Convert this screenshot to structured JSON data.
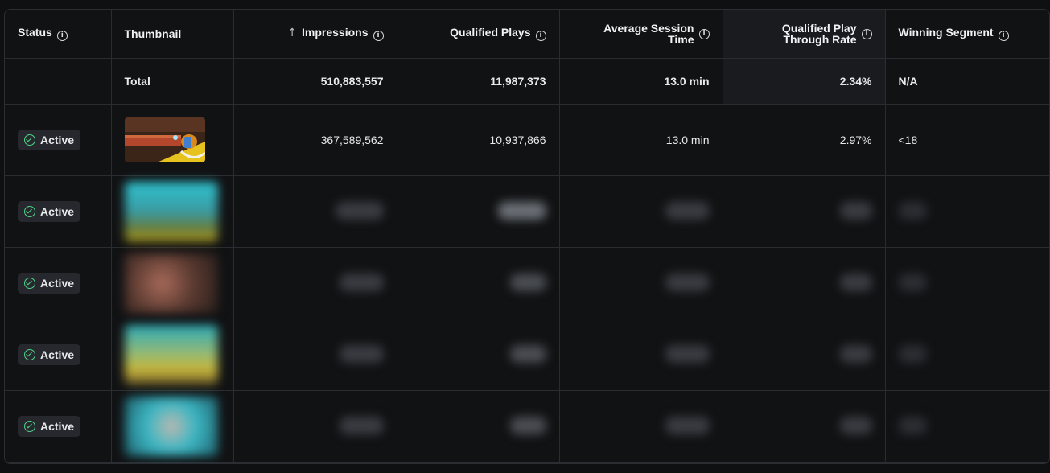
{
  "columns": {
    "status": "Status",
    "thumbnail": "Thumbnail",
    "impressions": "Impressions",
    "qualified_plays": "Qualified Plays",
    "avg_session_line1": "Average Session",
    "avg_session_line2": "Time",
    "qptr_line1": "Qualified Play",
    "qptr_line2": "Through Rate",
    "winning_segment": "Winning Segment"
  },
  "total": {
    "label": "Total",
    "impressions": "510,883,557",
    "qualified_plays": "11,987,373",
    "avg_session": "13.0 min",
    "qptr": "2.34%",
    "winning_segment": "N/A"
  },
  "rows": [
    {
      "status": "Active",
      "impressions": "367,589,562",
      "qualified_plays": "10,937,866",
      "avg_session": "13.0 min",
      "qptr": "2.97%",
      "winning_segment": "<18"
    },
    {
      "status": "Active"
    },
    {
      "status": "Active"
    },
    {
      "status": "Active"
    },
    {
      "status": "Active"
    }
  ],
  "icons": {
    "info": "info-icon",
    "sort": "arrow-up-icon",
    "status": "check-circle-icon"
  },
  "colors": {
    "active_check": "#4fd38a",
    "highlight_column": "#191b1f"
  }
}
